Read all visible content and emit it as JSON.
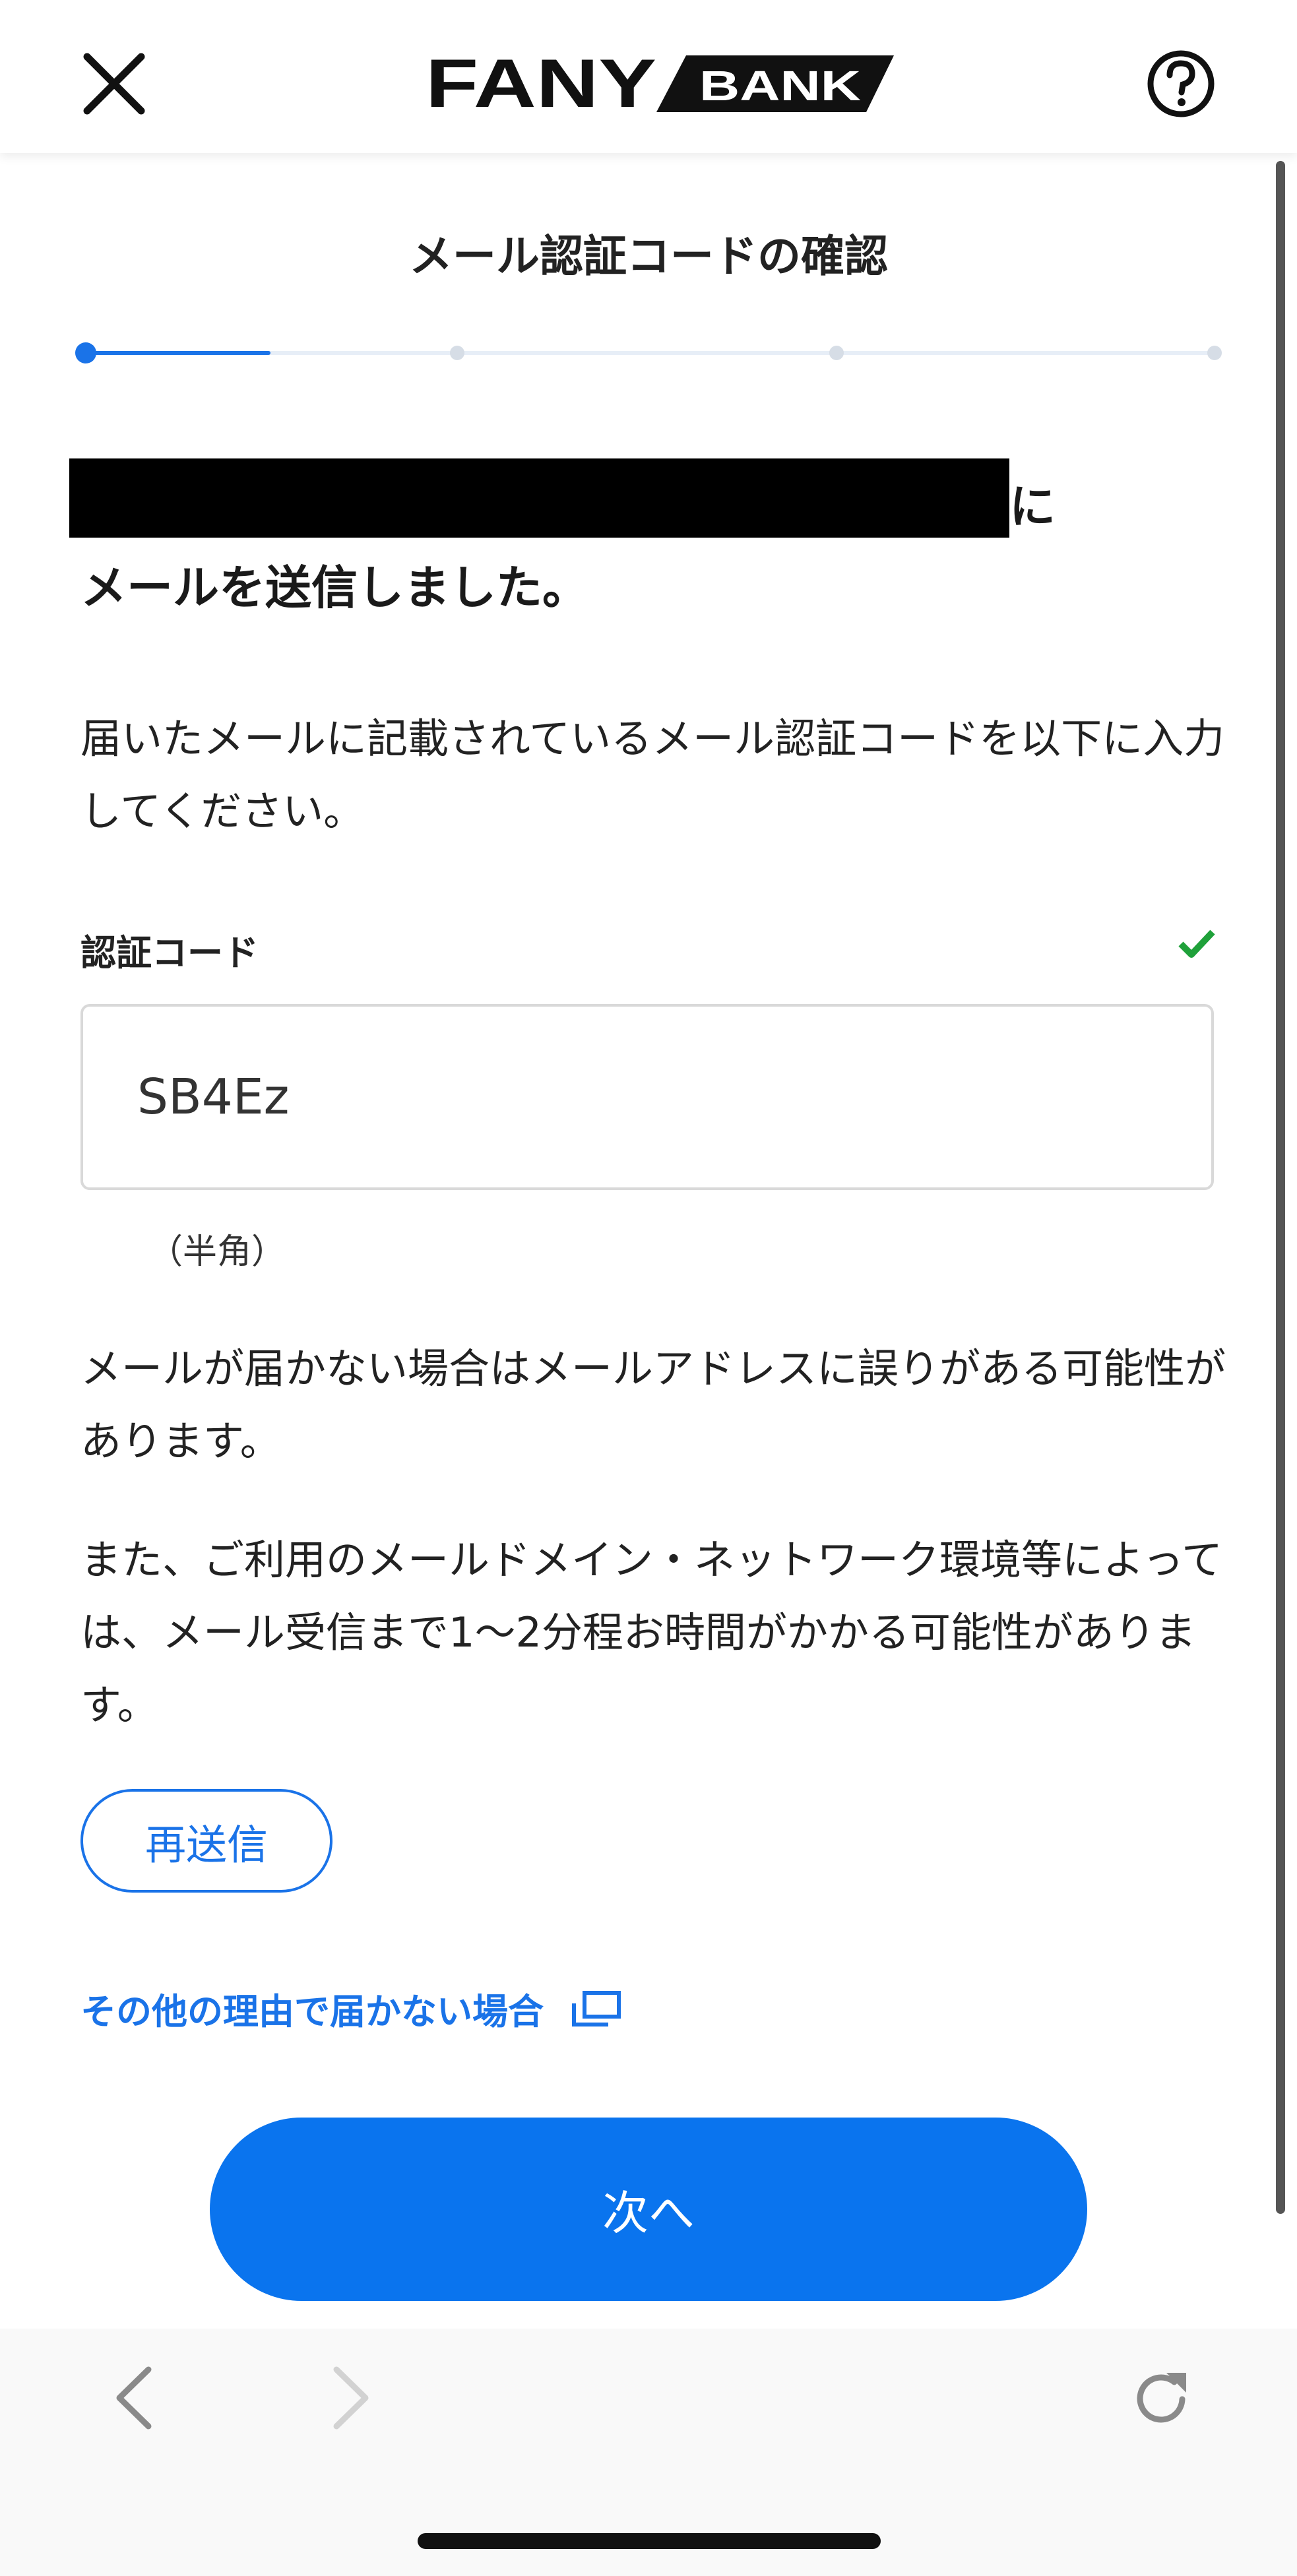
{
  "header": {
    "logo_main": "FANY",
    "logo_sub": "BANK"
  },
  "page_title": "メール認証コードの確認",
  "stepper": {
    "total_steps": 4,
    "current_step": 1
  },
  "recipient": {
    "email_redacted": true,
    "suffix": "に",
    "sent_message": "メールを送信しました。"
  },
  "instruction": "届いたメールに記載されているメール認証コードを以下に入力してください。",
  "code_field": {
    "label": "認証コード",
    "value": "SB4Ez",
    "hint": "（半角）",
    "valid": true
  },
  "notices": [
    "メールが届かない場合はメールアドレスに誤りがある可能性があります。",
    "また、ご利用のメールドメイン・ネットワーク環境等によっては、メール受信まで1～2分程お時間がかかる可能性があります。"
  ],
  "resend_label": "再送信",
  "other_reason_link": "その他の理由で届かない場合",
  "next_label": "次へ",
  "colors": {
    "accent": "#1a73e8",
    "primary_button": "#0a74ee",
    "valid_check": "#1fa13a"
  },
  "icons": [
    "close-icon",
    "help-icon",
    "check-icon",
    "external-link-icon",
    "back-arrow-icon",
    "forward-arrow-icon",
    "reload-icon"
  ]
}
